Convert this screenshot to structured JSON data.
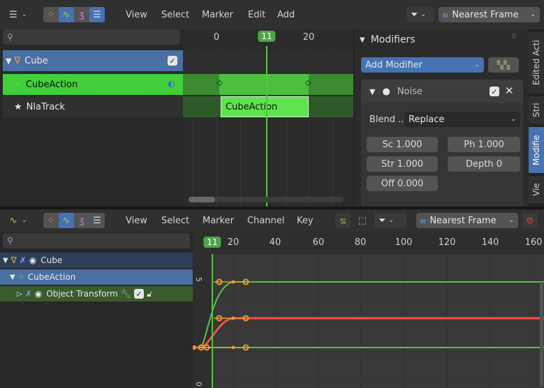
{
  "top_editor": {
    "menu": [
      "View",
      "Select",
      "Marker",
      "Edit",
      "Add"
    ],
    "snap_label": "Nearest Frame",
    "frames": [
      "0",
      "11",
      "20"
    ],
    "tracks": {
      "object": "Cube",
      "action": "CubeAction",
      "nla_track": "NlaTrack",
      "strip_label": "CubeAction"
    },
    "colors": {
      "selected_row": "#4a6fa3",
      "action_row": "#3fd03a",
      "playhead": "#57c24a",
      "strip": "#5ee24f"
    }
  },
  "modifiers_panel": {
    "title": "Modifiers",
    "add_modifier": "Add Modifier",
    "noise": {
      "name": "Noise",
      "blend_label": "Blend ...",
      "blend_value": "Replace",
      "scale": "Sc  1.000",
      "phase": "Ph  1.000",
      "strength": "Str  1.000",
      "depth": "Depth    0",
      "offset": "Off  0.000"
    },
    "side_tabs": [
      "Edited Acti",
      "Stri",
      "Modifie",
      "Vie"
    ]
  },
  "graph_editor": {
    "menu": [
      "View",
      "Select",
      "Marker",
      "Channel",
      "Key"
    ],
    "snap_label": "Nearest Frame",
    "frames": [
      "11",
      "20",
      "40",
      "60",
      "80",
      "100",
      "120",
      "140",
      "160"
    ],
    "y_labels": [
      "5",
      "0"
    ],
    "channels": {
      "object": "Cube",
      "action": "CubeAction",
      "group": "Object Transform"
    },
    "colors": {
      "curve_red": "#ff4d4d",
      "curve_green": "#53c64a",
      "keyframe": "#e69a2d"
    }
  }
}
